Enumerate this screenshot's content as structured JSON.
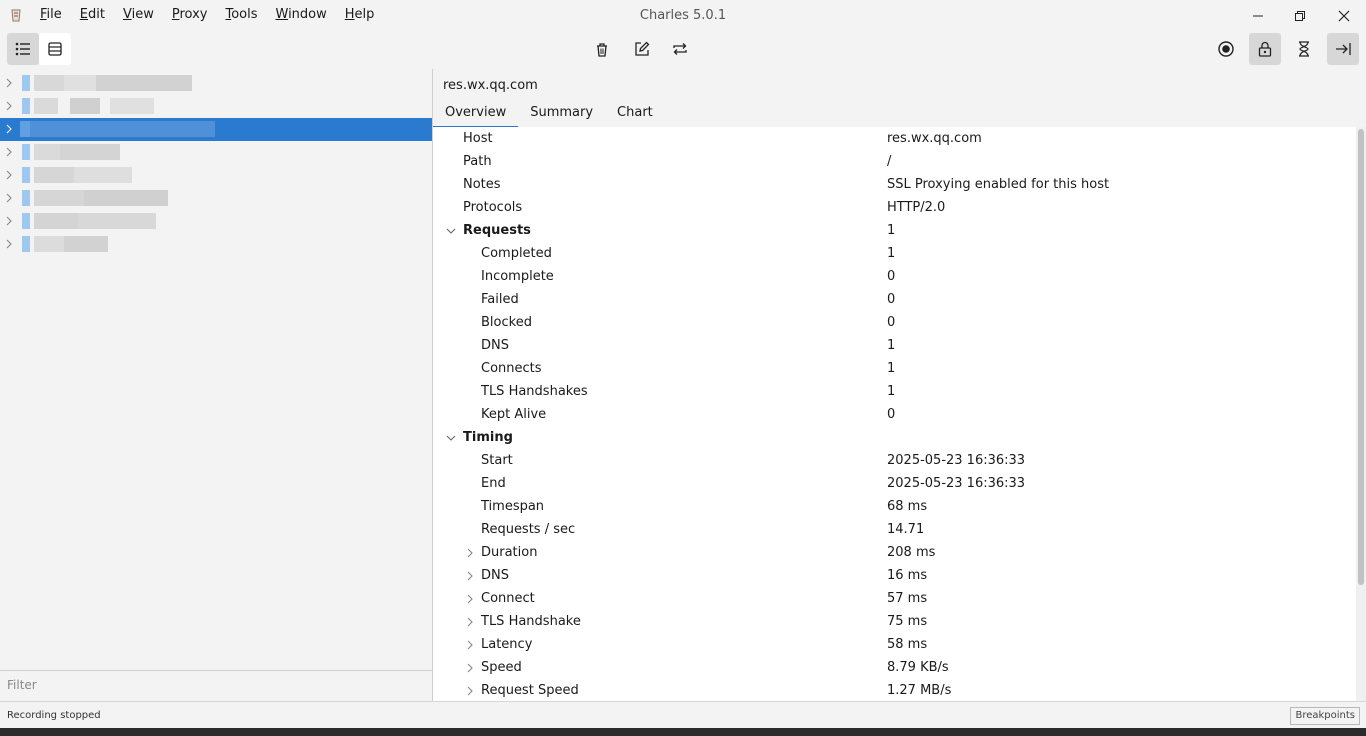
{
  "window": {
    "title": "Charles 5.0.1",
    "menu": [
      {
        "label": "File",
        "u": "F",
        "rest": "ile"
      },
      {
        "label": "Edit",
        "u": "E",
        "rest": "dit"
      },
      {
        "label": "View",
        "u": "V",
        "rest": "iew"
      },
      {
        "label": "Proxy",
        "u": "P",
        "rest": "roxy"
      },
      {
        "label": "Tools",
        "u": "T",
        "rest": "ools"
      },
      {
        "label": "Window",
        "u": "W",
        "rest": "indow"
      },
      {
        "label": "Help",
        "u": "H",
        "rest": "elp"
      }
    ]
  },
  "toolbar": {
    "left": [
      "structure-view-icon",
      "sequence-view-icon"
    ],
    "center": [
      "trash-icon",
      "edit-icon",
      "repeat-icon"
    ],
    "right": [
      "record-icon",
      "ssl-lock-icon",
      "throttle-hourglass-icon",
      "collapse-panel-icon"
    ]
  },
  "tree": {
    "row_count": 8,
    "selected_index": 2,
    "filter_placeholder": "Filter"
  },
  "detail": {
    "host_title": "res.wx.qq.com",
    "tabs": [
      "Overview",
      "Summary",
      "Chart"
    ],
    "active_tab": "Overview",
    "rows": [
      {
        "label": "Host",
        "value": "res.wx.qq.com",
        "level": 0
      },
      {
        "label": "Path",
        "value": "/",
        "level": 0
      },
      {
        "label": "Notes",
        "value": "SSL Proxying enabled for this host",
        "level": 0
      },
      {
        "label": "Protocols",
        "value": "HTTP/2.0",
        "level": 0
      },
      {
        "label": "Requests",
        "value": "1",
        "level": 0,
        "section": true,
        "expanded": true
      },
      {
        "label": "Completed",
        "value": "1",
        "level": 1
      },
      {
        "label": "Incomplete",
        "value": "0",
        "level": 1
      },
      {
        "label": "Failed",
        "value": "0",
        "level": 1
      },
      {
        "label": "Blocked",
        "value": "0",
        "level": 1
      },
      {
        "label": "DNS",
        "value": "1",
        "level": 1
      },
      {
        "label": "Connects",
        "value": "1",
        "level": 1
      },
      {
        "label": "TLS Handshakes",
        "value": "1",
        "level": 1
      },
      {
        "label": "Kept Alive",
        "value": "0",
        "level": 1
      },
      {
        "label": "Timing",
        "value": "",
        "level": 0,
        "section": true,
        "expanded": true
      },
      {
        "label": "Start",
        "value": "2025-05-23 16:36:33",
        "level": 1
      },
      {
        "label": "End",
        "value": "2025-05-23 16:36:33",
        "level": 1
      },
      {
        "label": "Timespan",
        "value": "68 ms",
        "level": 1
      },
      {
        "label": "Requests / sec",
        "value": "14.71",
        "level": 1
      },
      {
        "label": "Duration",
        "value": "208 ms",
        "level": 1,
        "collapsed": true
      },
      {
        "label": "DNS",
        "value": "16 ms",
        "level": 1,
        "collapsed": true
      },
      {
        "label": "Connect",
        "value": "57 ms",
        "level": 1,
        "collapsed": true
      },
      {
        "label": "TLS Handshake",
        "value": "75 ms",
        "level": 1,
        "collapsed": true
      },
      {
        "label": "Latency",
        "value": "58 ms",
        "level": 1,
        "collapsed": true
      },
      {
        "label": "Speed",
        "value": "8.79 KB/s",
        "level": 1,
        "collapsed": true
      },
      {
        "label": "Request Speed",
        "value": "1.27 MB/s",
        "level": 1,
        "collapsed": true
      }
    ]
  },
  "status": {
    "text": "Recording stopped",
    "breakpoints_label": "Breakpoints"
  },
  "colors": {
    "selection": "#2a7ad0",
    "background": "#f3f3f3"
  }
}
